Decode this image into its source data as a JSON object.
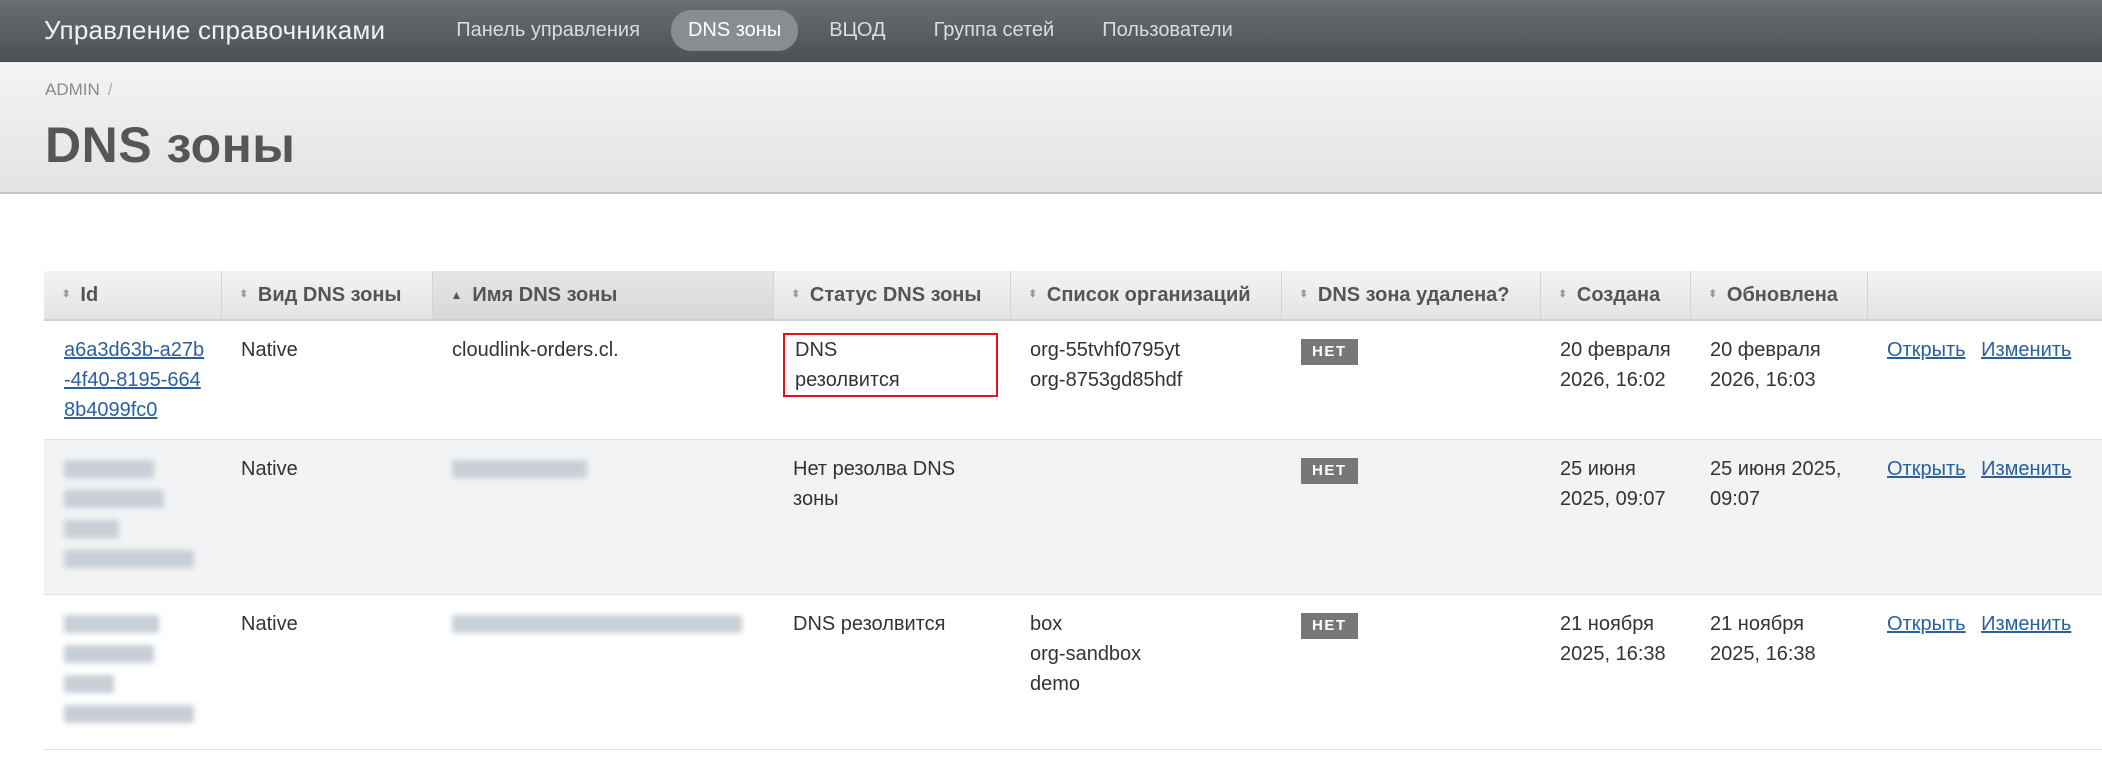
{
  "app": {
    "title": "Управление справочниками"
  },
  "nav": {
    "items": [
      {
        "label": "Панель управления",
        "active": false
      },
      {
        "label": "DNS зоны",
        "active": true
      },
      {
        "label": "ВЦОД",
        "active": false
      },
      {
        "label": "Группа сетей",
        "active": false
      },
      {
        "label": "Пользователи",
        "active": false
      }
    ]
  },
  "breadcrumb": {
    "root": "ADMIN",
    "separator": "/"
  },
  "page": {
    "title": "DNS зоны"
  },
  "table": {
    "columns": [
      "Id",
      "Вид DNS зоны",
      "Имя DNS зоны",
      "Статус DNS зоны",
      "Список организаций",
      "DNS зона удалена?",
      "Создана",
      "Обновлена"
    ],
    "rows": [
      {
        "id": "a6a3d63b-a27b-4f40-8195-6648b4099fc0",
        "type": "Native",
        "name": "cloudlink-orders.cl.",
        "status": "DNS резолвится",
        "orgs": [
          "org-55tvhf0795yt",
          "org-8753gd85hdf"
        ],
        "deleted": "НЕТ",
        "created": "20 февраля 2026, 16:02",
        "updated": "20 февраля 2026, 16:03",
        "open": "Открыть",
        "edit": "Изменить"
      },
      {
        "id": "",
        "type": "Native",
        "name": "",
        "status": "Нет резолва DNS зоны",
        "orgs": [],
        "deleted": "НЕТ",
        "created": "25 июня 2025, 09:07",
        "updated": "25 июня 2025, 09:07",
        "open": "Открыть",
        "edit": "Изменить"
      },
      {
        "id": "",
        "type": "Native",
        "name": "",
        "status": "DNS резолвится",
        "orgs": [
          "box",
          "org-sandbox",
          "demo"
        ],
        "deleted": "НЕТ",
        "created": "21 ноября 2025, 16:38",
        "updated": "21 ноября 2025, 16:38",
        "open": "Открыть",
        "edit": "Изменить"
      }
    ]
  }
}
